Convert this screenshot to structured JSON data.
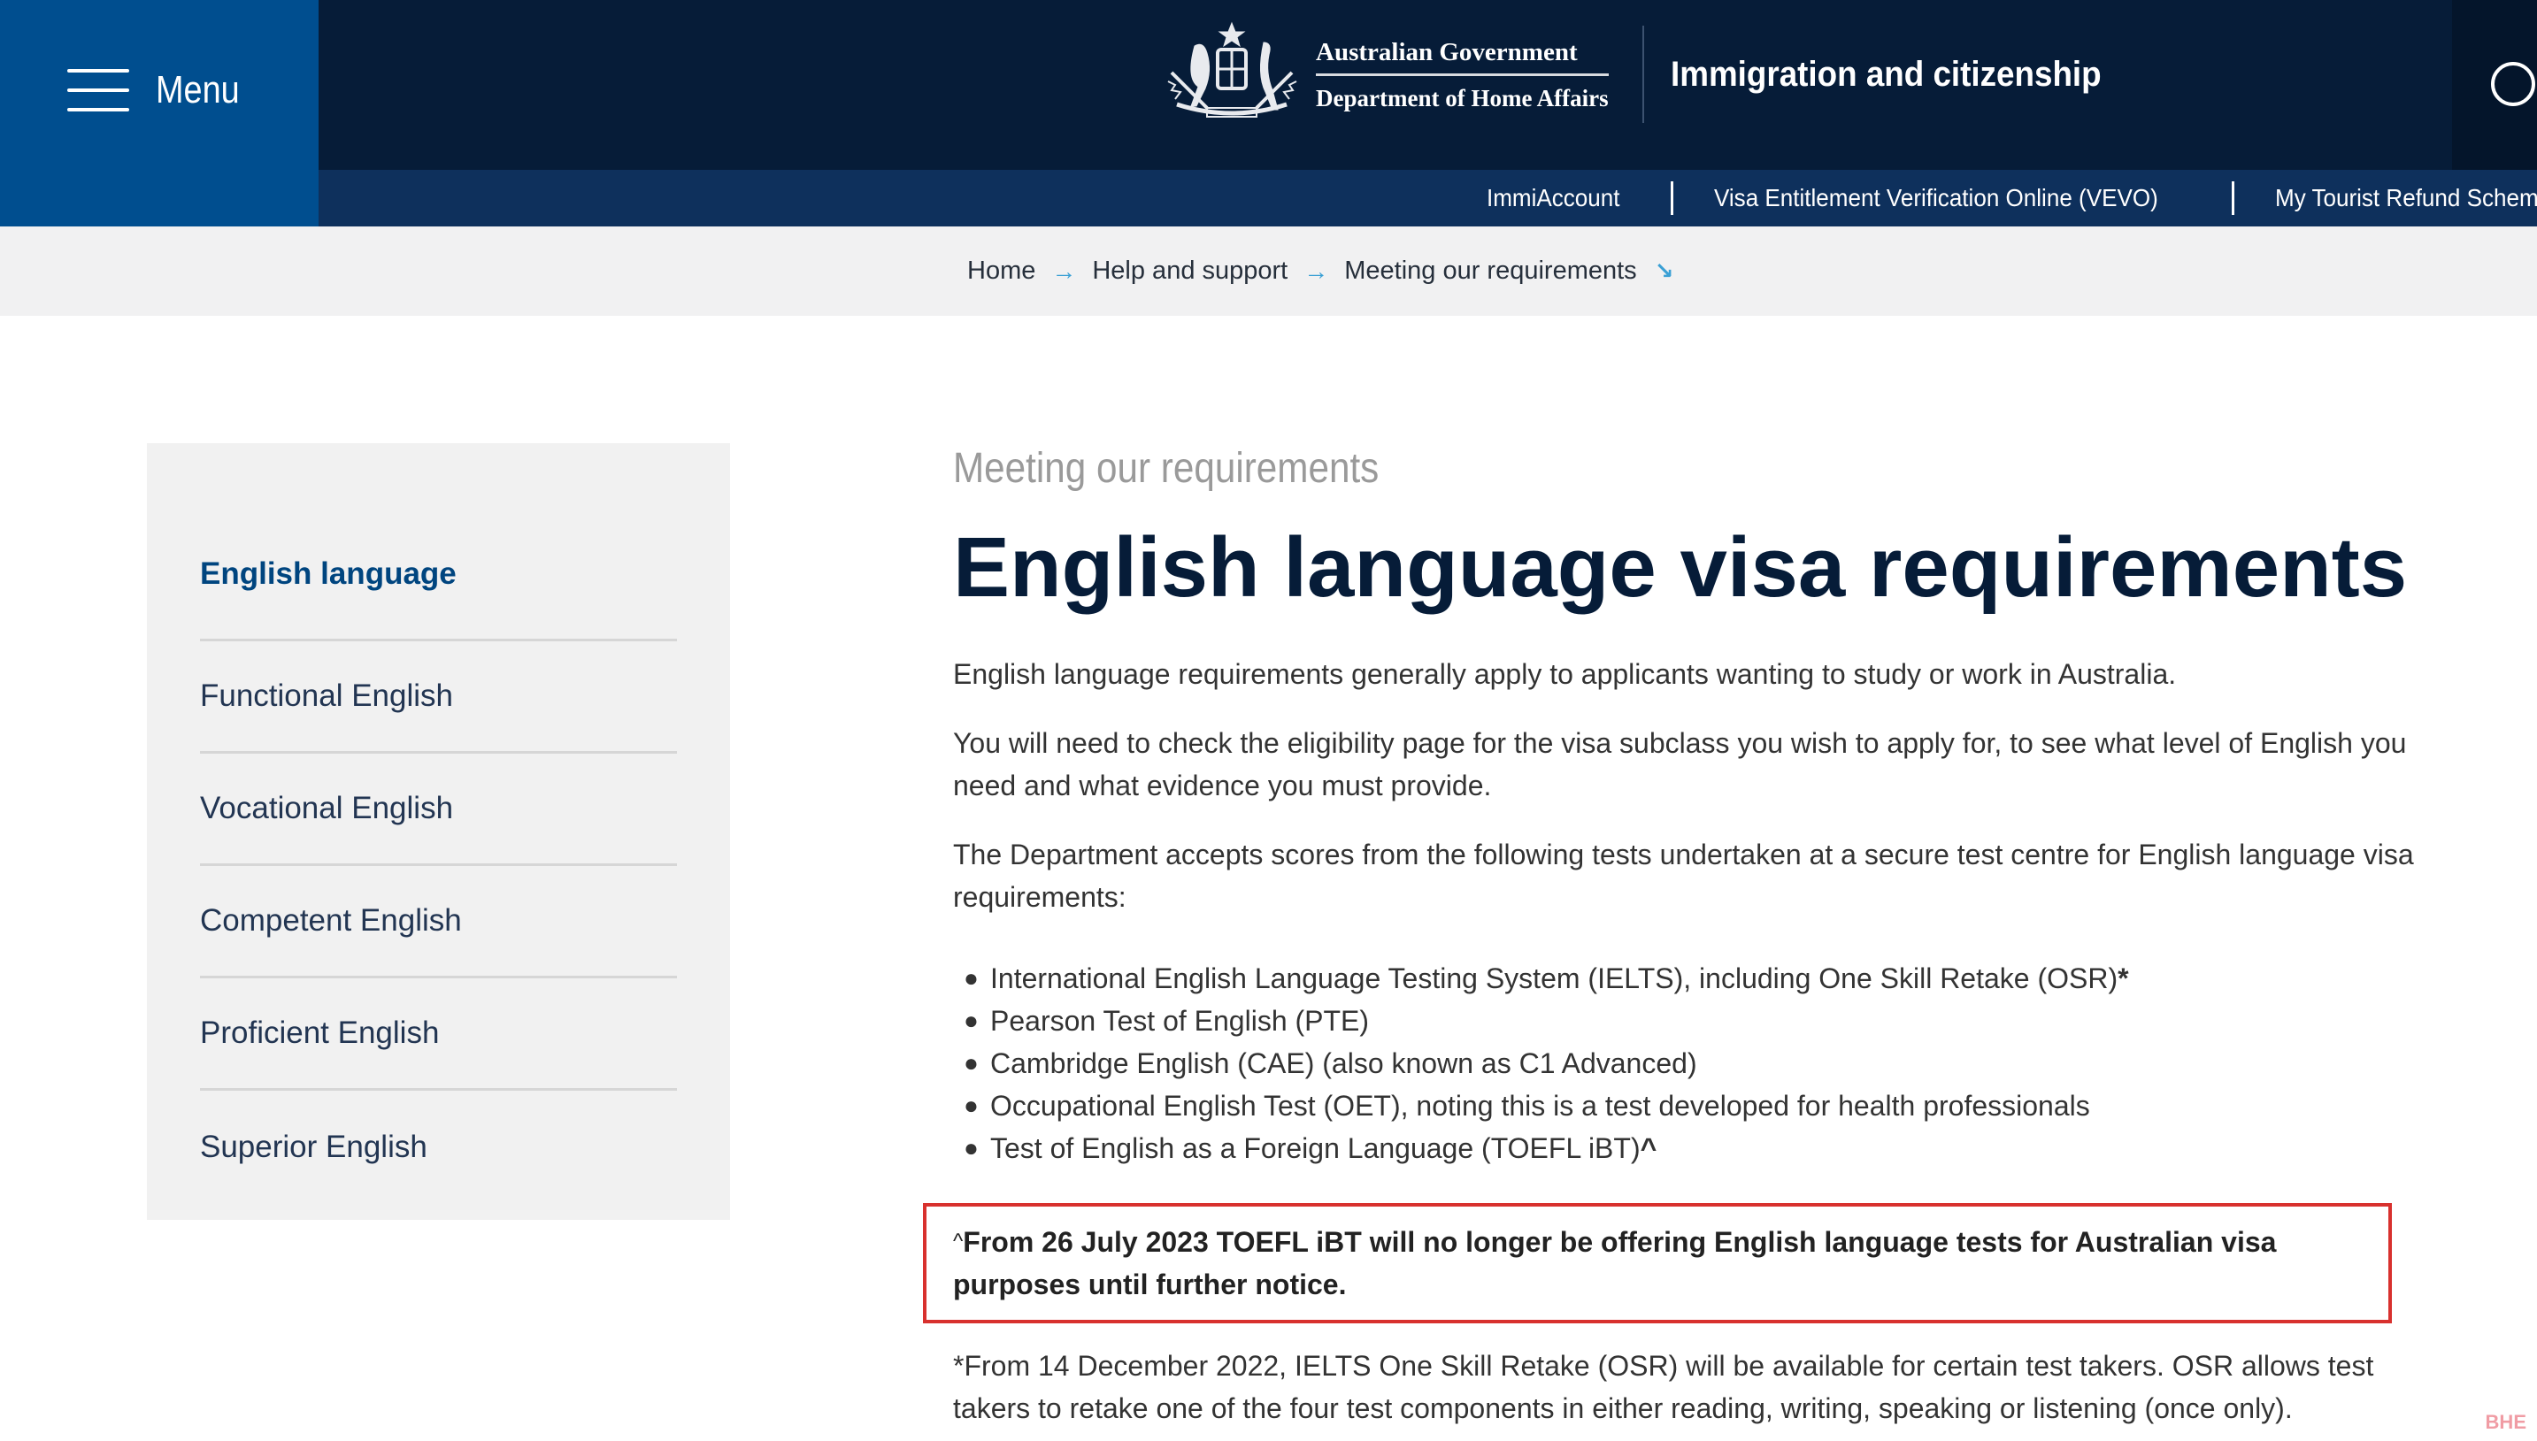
{
  "header": {
    "menu_label": "Menu",
    "gov_line1": "Australian Government",
    "gov_line2": "Department of Home Affairs",
    "site_name": "Immigration and citizenship",
    "utility_links": [
      {
        "label": "ImmiAccount"
      },
      {
        "label": "Visa Entitlement Verification Online (VEVO)"
      },
      {
        "label": "My Tourist Refund Scheme (T"
      }
    ],
    "colors": {
      "menu_bg": "#004e8f",
      "header_bg": "#061c38",
      "util_bg": "#0e305c"
    }
  },
  "breadcrumb": {
    "items": [
      {
        "label": "Home"
      },
      {
        "label": "Help and support"
      },
      {
        "label": "Meeting our requirements"
      }
    ],
    "separator_icon": "arrow-right-icon",
    "expand_icon": "arrow-down-right-icon"
  },
  "sidebar": {
    "items": [
      {
        "label": "English language",
        "active": true
      },
      {
        "label": "Functional English"
      },
      {
        "label": "Vocational English"
      },
      {
        "label": "Competent English"
      },
      {
        "label": "Proficient English"
      },
      {
        "label": "Superior English"
      }
    ]
  },
  "main": {
    "kicker": "Meeting our requirements",
    "title": "English language visa requirements",
    "para1": "English language requirements generally apply to applicants wanting to study or work in Australia.",
    "para2": "You will need to check the eligibility page for the visa subclass you wish to apply for, to see what level of English you need and what evidence you must provide.",
    "para3": "The Department accepts scores from the following tests undertaken at a secure test centre for English language visa requirements:",
    "tests": [
      {
        "text": "International English Language Testing System (IELTS), including One Skill Retake (OSR)",
        "mark": "*"
      },
      {
        "text": "Pearson Test of English (PTE)",
        "mark": ""
      },
      {
        "text": "Cambridge English (CAE) (also known as C1 Advanced)",
        "mark": ""
      },
      {
        "text": "Occupational English Test (OET), noting this is a test developed for health professionals",
        "mark": ""
      },
      {
        "text": "Test of English as a Foreign Language (TOEFL iBT)",
        "mark": "^"
      }
    ],
    "notice_caret": "^",
    "notice": "From 26 July 2023 TOEFL iBT will no longer be offering English language tests for Australian visa purposes until further notice.",
    "footnote": "*From 14 December 2022, IELTS One Skill Retake (OSR) will be available for certain test takers. OSR allows test takers to retake one of the four test components in either reading, writing, speaking or listening (once only).",
    "notice_border_color": "#d8312e"
  },
  "watermark": "BHE"
}
